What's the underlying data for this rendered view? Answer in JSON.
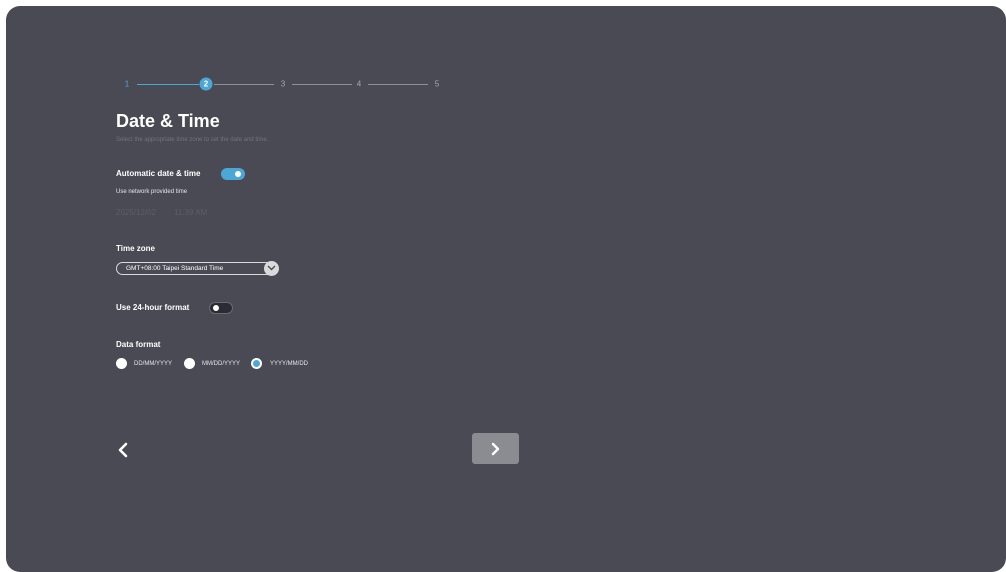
{
  "stepper": {
    "steps": [
      "1",
      "2",
      "3",
      "4",
      "5"
    ],
    "current_step": 2
  },
  "page": {
    "title": "Date & Time",
    "subtitle": "Select the appropriate time zone to set the date and time."
  },
  "auto_datetime": {
    "label": "Automatic date & time",
    "enabled": true,
    "description": "Use network provided time",
    "date_value": "2025/12/02",
    "time_value": "11:39 AM"
  },
  "timezone": {
    "label": "Time zone",
    "selected": "GMT+08:00 Taipei Standard Time"
  },
  "hour_format": {
    "label": "Use 24-hour format",
    "enabled": false
  },
  "date_format": {
    "label": "Data format",
    "options": [
      "DD/MM/YYYY",
      "MM/DD/YYYY",
      "YYYY/MM/DD"
    ],
    "selected": "YYYY/MM/DD"
  },
  "icons": {
    "back": "chevron-left-icon",
    "next": "chevron-right-icon",
    "dropdown": "chevron-down-icon"
  },
  "colors": {
    "background": "#4a4a54",
    "accent": "#4aa7d6",
    "next_button": "#8b8b92"
  }
}
